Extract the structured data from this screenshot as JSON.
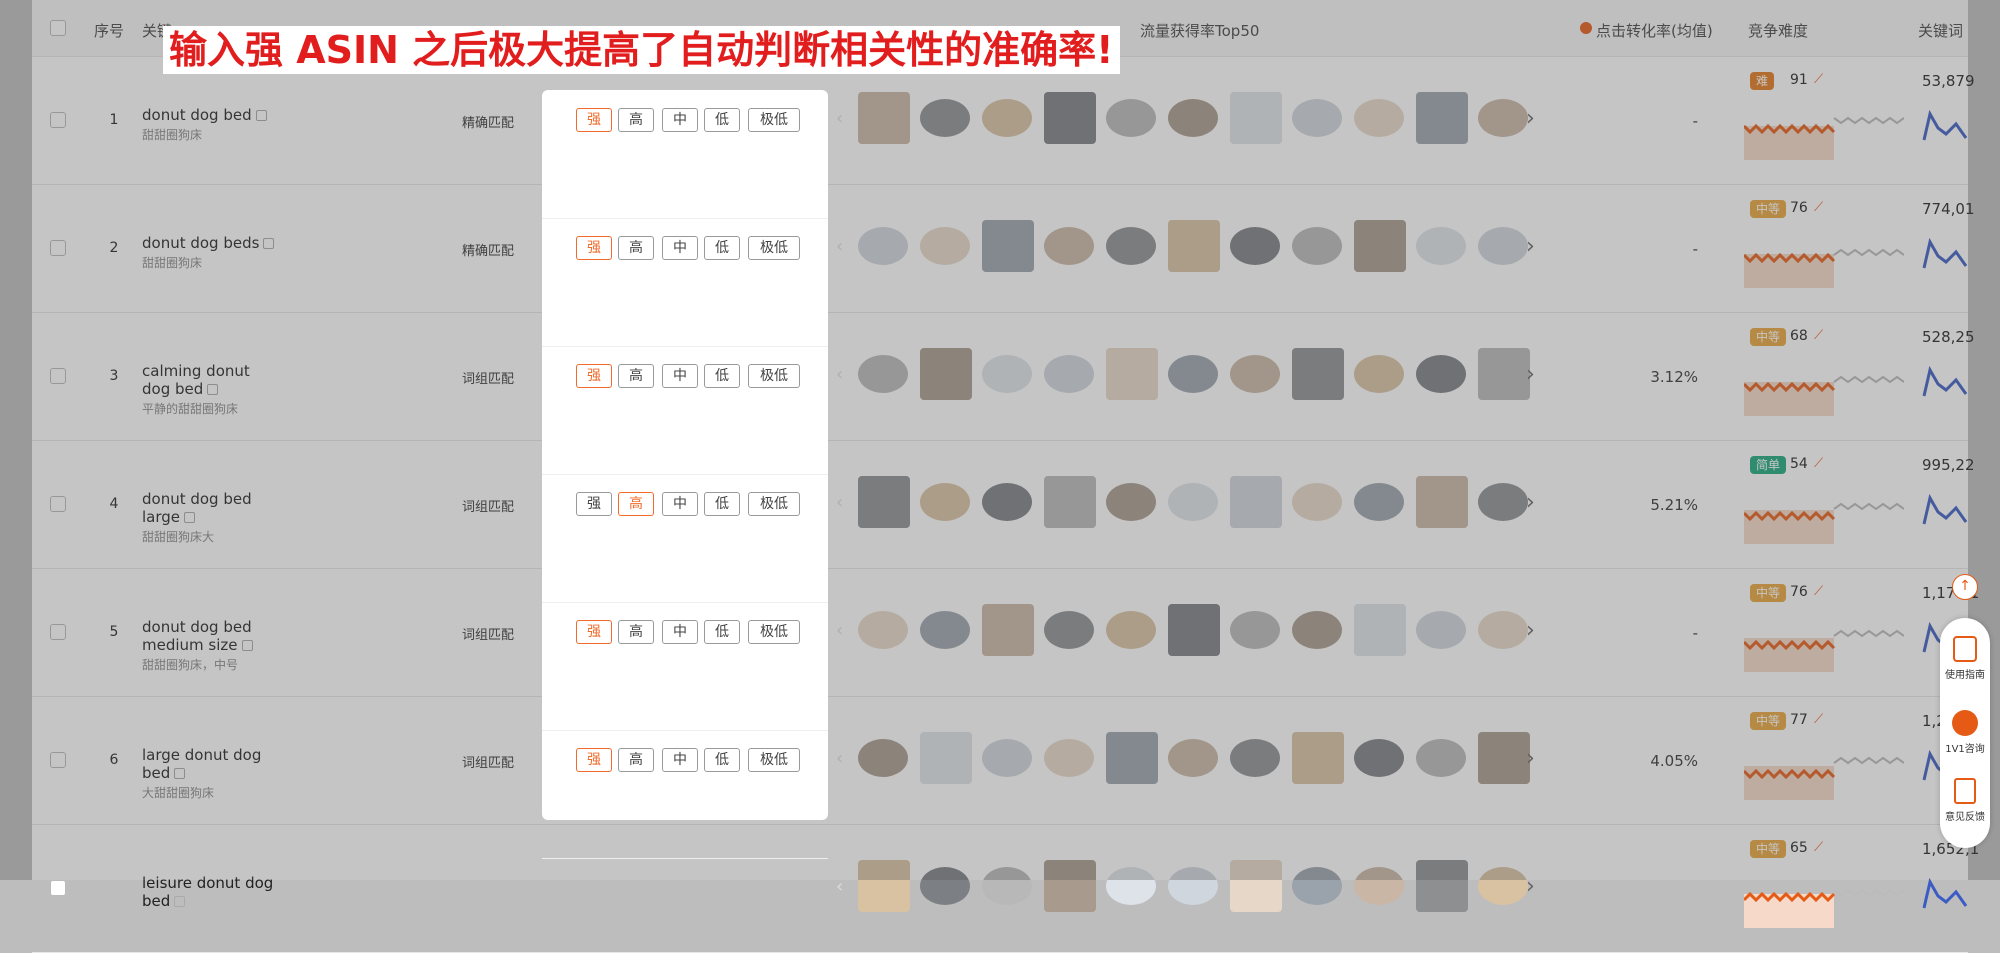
{
  "overlay_title": "输入强 ASIN 之后极大提高了自动判断相关性的准确率!",
  "header": {
    "seq": "序号",
    "keyword": "关键",
    "traffic": "流量获得率Top50",
    "conversion": "点击转化率(均值)",
    "competition": "竞争难度",
    "keyword_vol": "关键词"
  },
  "levels": [
    "强",
    "高",
    "中",
    "低",
    "极低"
  ],
  "rows": [
    {
      "idx": "1",
      "kw": "donut dog bed",
      "cn": "甜甜圈狗床",
      "match": "精确匹配",
      "sel": 0,
      "conv": "-",
      "badge": "难",
      "badge_color": "#e5791b",
      "score": "91",
      "vol": "53,879"
    },
    {
      "idx": "2",
      "kw": "donut dog beds",
      "cn": "甜甜圈狗床",
      "match": "精确匹配",
      "sel": 0,
      "conv": "-",
      "badge": "中等",
      "badge_color": "#e9a53a",
      "score": "76",
      "vol": "774,01"
    },
    {
      "idx": "3",
      "kw": "calming donut dog bed",
      "cn": "平静的甜甜圈狗床",
      "match": "词组匹配",
      "sel": 0,
      "conv": "3.12%",
      "badge": "中等",
      "badge_color": "#e9a53a",
      "score": "68",
      "vol": "528,25"
    },
    {
      "idx": "4",
      "kw": "donut dog bed large",
      "cn": "甜甜圈狗床大",
      "match": "词组匹配",
      "sel": 1,
      "conv": "5.21%",
      "badge": "简单",
      "badge_color": "#1aa87b",
      "score": "54",
      "vol": "995,22"
    },
    {
      "idx": "5",
      "kw": "donut dog bed medium size",
      "cn": "甜甜圈狗床，中号",
      "match": "词组匹配",
      "sel": 0,
      "conv": "-",
      "badge": "中等",
      "badge_color": "#e9a53a",
      "score": "76",
      "vol": "1,177,1"
    },
    {
      "idx": "6",
      "kw": "large donut dog bed",
      "cn": "大甜甜圈狗床",
      "match": "词组匹配",
      "sel": 0,
      "conv": "4.05%",
      "badge": "中等",
      "badge_color": "#e9a53a",
      "score": "77",
      "vol": "1,2"
    },
    {
      "idx": "",
      "kw": "leisure donut dog bed",
      "cn": "",
      "match": "",
      "sel": 0,
      "conv": "",
      "badge": "中等",
      "badge_color": "#e9a53a",
      "score": "65",
      "vol": "1,652,1"
    }
  ],
  "sidebar": {
    "guide": "使用指南",
    "consult": "1V1咨询",
    "feedback": "意见反馈"
  },
  "colors": {
    "accent": "#f26b2b",
    "title_red": "#e21d1d"
  }
}
